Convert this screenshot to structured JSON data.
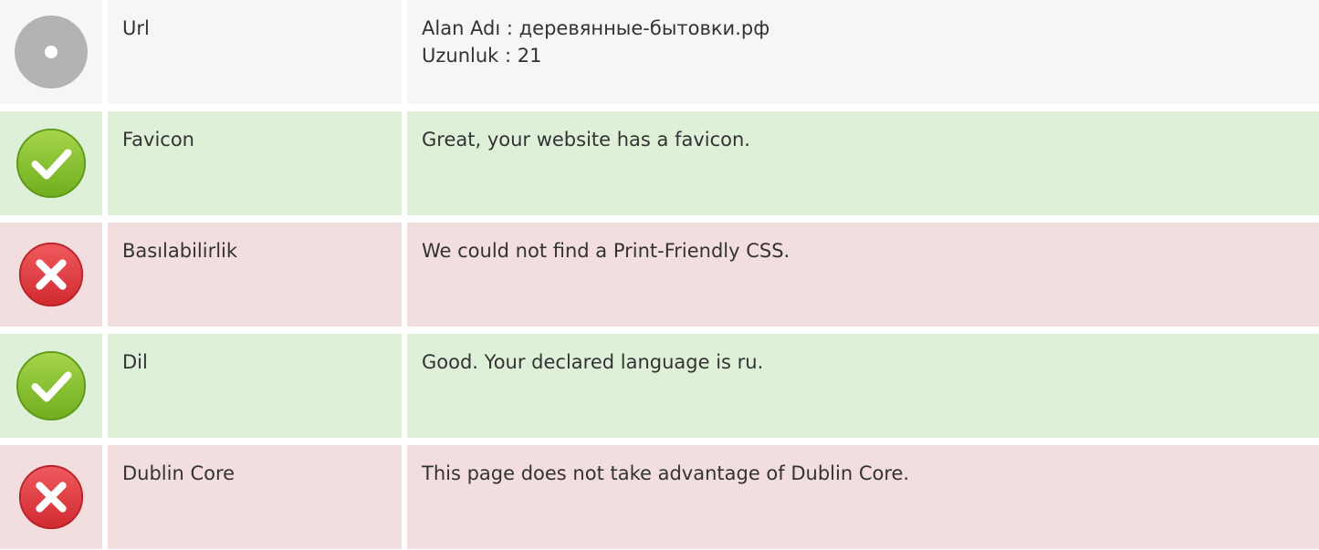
{
  "rows": [
    {
      "status": "neutral",
      "icon": "info-dot-icon",
      "label": "Url",
      "lines": [
        "Alan Adı : деревянные-бытовки.рф",
        "Uzunluk : 21"
      ]
    },
    {
      "status": "good",
      "icon": "check-icon",
      "label": "Favicon",
      "lines": [
        "Great, your website has a favicon."
      ]
    },
    {
      "status": "bad",
      "icon": "cross-icon",
      "label": "Basılabilirlik",
      "lines": [
        "We could not find a Print-Friendly CSS."
      ]
    },
    {
      "status": "good",
      "icon": "check-icon",
      "label": "Dil",
      "lines": [
        "Good. Your declared language is ru."
      ]
    },
    {
      "status": "bad",
      "icon": "cross-icon",
      "label": "Dublin Core",
      "lines": [
        "This page does not take advantage of Dublin Core."
      ]
    }
  ],
  "colors": {
    "neutral_bg": "#f6f6f6",
    "good_bg": "#dff0d8",
    "bad_bg": "#f2dede",
    "check_green": "#8cc63f",
    "cross_red": "#e0393e",
    "neutral_grey": "#b3b3b3"
  }
}
